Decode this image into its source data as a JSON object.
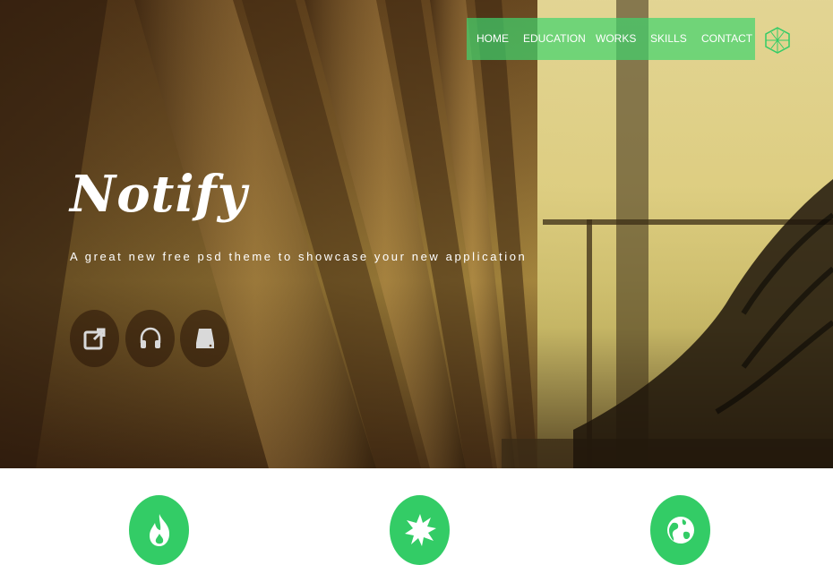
{
  "nav": {
    "items": [
      {
        "label": "HOME"
      },
      {
        "label": "EDUCATION"
      },
      {
        "label": "WORKS"
      },
      {
        "label": "SKILLS"
      },
      {
        "label": "CONTACT"
      }
    ],
    "background": "#40d46e"
  },
  "hero": {
    "brand": "Notify",
    "tagline": "A great new free psd theme to showcase your new application",
    "buttons": [
      {
        "icon": "share-icon"
      },
      {
        "icon": "headphones-icon"
      },
      {
        "icon": "drive-icon"
      }
    ]
  },
  "features": [
    {
      "icon": "flame-icon"
    },
    {
      "icon": "burst-icon"
    },
    {
      "icon": "globe-icon"
    }
  ],
  "colors": {
    "accent": "#33cc66",
    "text": "#ffffff"
  }
}
